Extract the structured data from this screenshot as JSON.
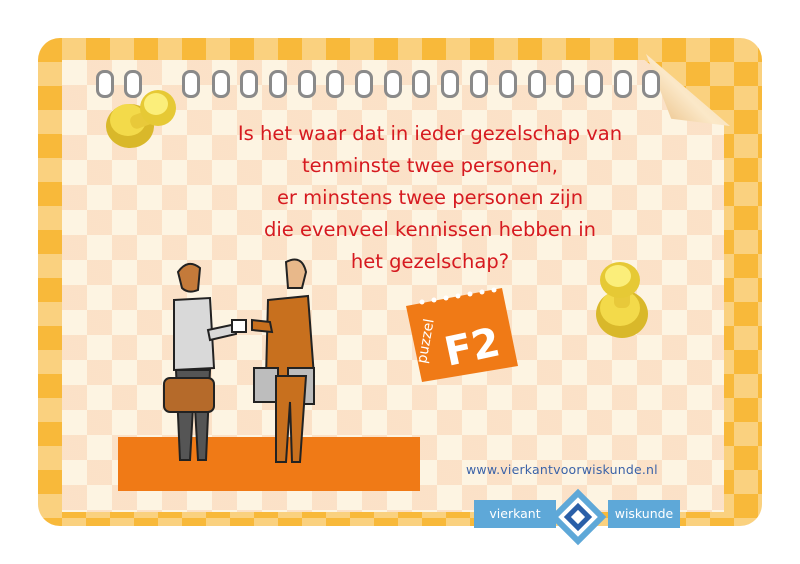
{
  "question": {
    "lines": [
      "Is het waar dat in ieder gezelschap van",
      "tenminste twee personen,",
      "er minstens twee personen zijn",
      "die evenveel kennissen hebben in",
      "het gezelschap?"
    ]
  },
  "tag": {
    "label": "puzzel",
    "code": "F2"
  },
  "footer": {
    "url": "www.vierkantvoorwiskunde.nl",
    "logo_left": "vierkant",
    "logo_right": "wiskunde"
  },
  "colors": {
    "text_red": "#d61a20",
    "orange": "#f07a16",
    "logo_blue": "#5ea8d8",
    "card_yellow": "#f8b93a"
  },
  "icons": [
    "push-pin-icon",
    "handshake-people-illustration",
    "vierkant-voor-wiskunde-logo-icon"
  ]
}
